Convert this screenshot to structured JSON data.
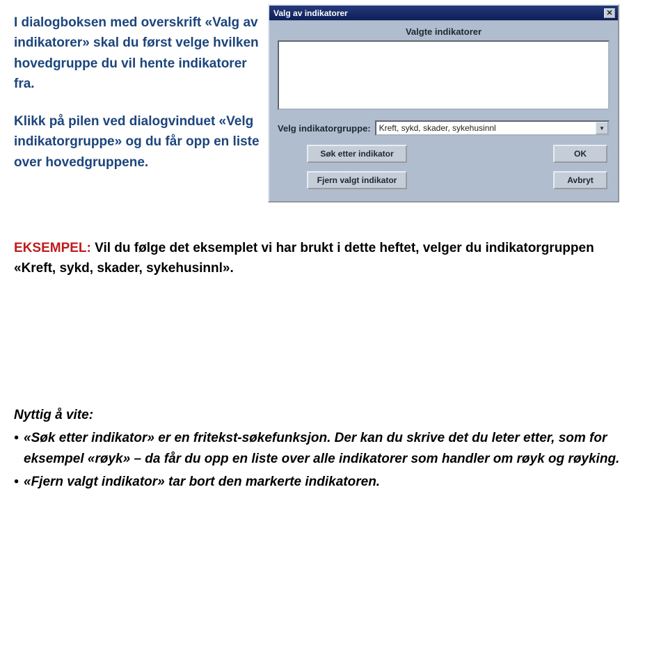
{
  "leftText": {
    "p1": "I dialogboksen med overskrift «Valg av indikatorer» skal du først velge hvilken hovedgruppe du vil hente indikatorer fra.",
    "p2": "Klikk på pilen ved dialogvinduet «Velg indikatorgruppe» og du får opp en liste over hovedgruppene."
  },
  "dialog": {
    "title": "Valg av indikatorer",
    "closeGlyph": "✕",
    "selectedLabel": "Valgte indikatorer",
    "groupLabel": "Velg indikatorgruppe:",
    "groupValue": "Kreft, sykd, skader, sykehusinnl",
    "btnSearch": "Søk etter indikator",
    "btnRemove": "Fjern valgt indikator",
    "btnOk": "OK",
    "btnCancel": "Avbryt"
  },
  "example": {
    "label": "EKSEMPEL:",
    "text": " Vil du følge det eksemplet vi har brukt i dette heftet, velger du indikator­gruppen «Kreft, sykd, skader, sykehusinnl»."
  },
  "nyttig": {
    "heading": "Nyttig å vite:",
    "b1": "«Søk etter indikator» er en fritekst-søkefunksjon. Der kan du skrive det du leter etter, som for eksempel «røyk» – da får du opp en liste over alle indikatorer som handler om røyk og røyking.",
    "b2": "«Fjern valgt indikator» tar bort den markerte indikatoren."
  }
}
